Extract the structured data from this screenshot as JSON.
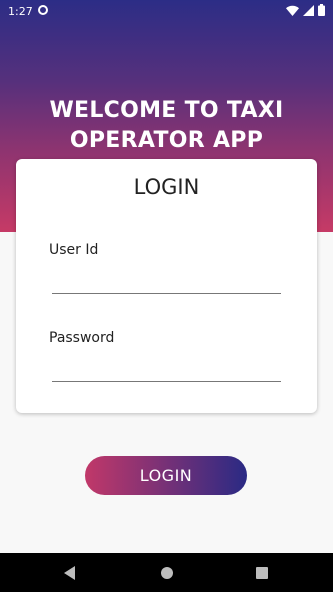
{
  "status_bar": {
    "time": "1:27"
  },
  "hero": {
    "title_line1": "WELCOME TO TAXI",
    "title_line2": "OPERATOR APP"
  },
  "card": {
    "title": "LOGIN",
    "user_id_label": "User Id",
    "user_id_value": "",
    "password_label": "Password",
    "password_value": ""
  },
  "actions": {
    "login_label": "LOGIN"
  },
  "colors": {
    "gradient_top": "#2c2d86",
    "gradient_bottom": "#c63a66",
    "background": "#f8f8f8"
  }
}
